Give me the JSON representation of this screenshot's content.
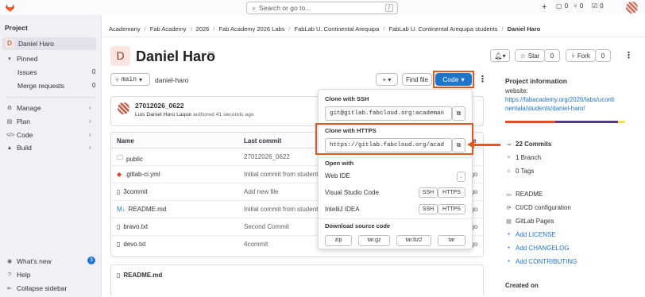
{
  "topbar": {
    "search_placeholder": "Search or go to...",
    "search_shortcut": "/",
    "counts": {
      "issues": "0",
      "mr": "0",
      "todo": "0"
    }
  },
  "sidebar": {
    "heading": "Project",
    "project_name": "Daniel Haro",
    "project_initial": "D",
    "items": [
      {
        "label": "Pinned"
      },
      {
        "label": "Issues",
        "count": "0"
      },
      {
        "label": "Merge requests",
        "count": "0"
      },
      {
        "label": "Manage"
      },
      {
        "label": "Plan"
      },
      {
        "label": "Code"
      },
      {
        "label": "Build"
      }
    ],
    "bottom": {
      "whats_new": "What's new",
      "whats_new_count": "3",
      "help": "Help",
      "collapse": "Collapse sidebar"
    }
  },
  "breadcrumb": [
    "Academany",
    "Fab Academy",
    "2026",
    "Fab Academy 2026 Labs",
    "FabLab U. Continental Arequipa",
    "FabLab U. Continental Arequipa students",
    "Daniel Haro"
  ],
  "project": {
    "initial": "D",
    "title": "Daniel Haro"
  },
  "header_buttons": {
    "star": "Star",
    "star_count": "0",
    "fork": "Fork",
    "fork_count": "0"
  },
  "toolbar": {
    "branch": "main",
    "path": "daniel-haro",
    "find_file": "Find file",
    "code": "Code"
  },
  "commit": {
    "title": "27012026_0622",
    "author": "Luis Daniel Haro Laque",
    "meta": "authored 41 seconds ago"
  },
  "table": {
    "headers": {
      "name": "Name",
      "last_commit": "Last commit",
      "date": "ate"
    },
    "rows": [
      {
        "name": "public",
        "icon": "folder",
        "commit": "27012026_0622",
        "date": ""
      },
      {
        "name": ".gitlab-ci.yml",
        "icon": "gitlab",
        "commit": "Initial commit from student",
        "date": "ago"
      },
      {
        "name": "3commit",
        "icon": "file",
        "commit": "Add new file",
        "date": "ago"
      },
      {
        "name": "README.md",
        "icon": "markdown",
        "commit": "Initial commit from student",
        "date": "ago"
      },
      {
        "name": "bravo.txt",
        "icon": "file",
        "commit": "Second Commit",
        "date": "ago"
      },
      {
        "name": "devo.txt",
        "icon": "file",
        "commit": "4commit",
        "date": "ago"
      }
    ]
  },
  "readme_header": "README.md",
  "dropdown": {
    "ssh_label": "Clone with SSH",
    "ssh_url": "git@gitlab.fabcloud.org:academan",
    "https_label": "Clone with HTTPS",
    "https_url": "https://gitlab.fabcloud.org/acad",
    "open_with": "Open with",
    "web_ide": "Web IDE",
    "vscode": "Visual Studio Code",
    "intellij": "IntelliJ IDEA",
    "ssh": "SSH",
    "https": "HTTPS",
    "download": "Download source code",
    "formats": [
      "zip",
      "tar.gz",
      "tar.bz2",
      "tar"
    ]
  },
  "right_panel": {
    "heading": "Project information",
    "website_label": "website:",
    "website_url_1": "https://fabacademy.org/2026/labs/uconti",
    "website_url_2": "nentala/students/daniel-haro/",
    "commits": "22 Commits",
    "branch": "1 Branch",
    "tags": "0 Tags",
    "links": [
      "README",
      "CI/CD configuration",
      "GitLab Pages",
      "Add LICENSE",
      "Add CHANGELOG",
      "Add CONTRIBUTING"
    ],
    "created_on": "Created on"
  },
  "colors": {
    "accent": "#1f75cb",
    "highlight": "#e2581f",
    "lang1": "#e34c26",
    "lang2": "#563d7c",
    "lang3": "#f1e05a"
  }
}
